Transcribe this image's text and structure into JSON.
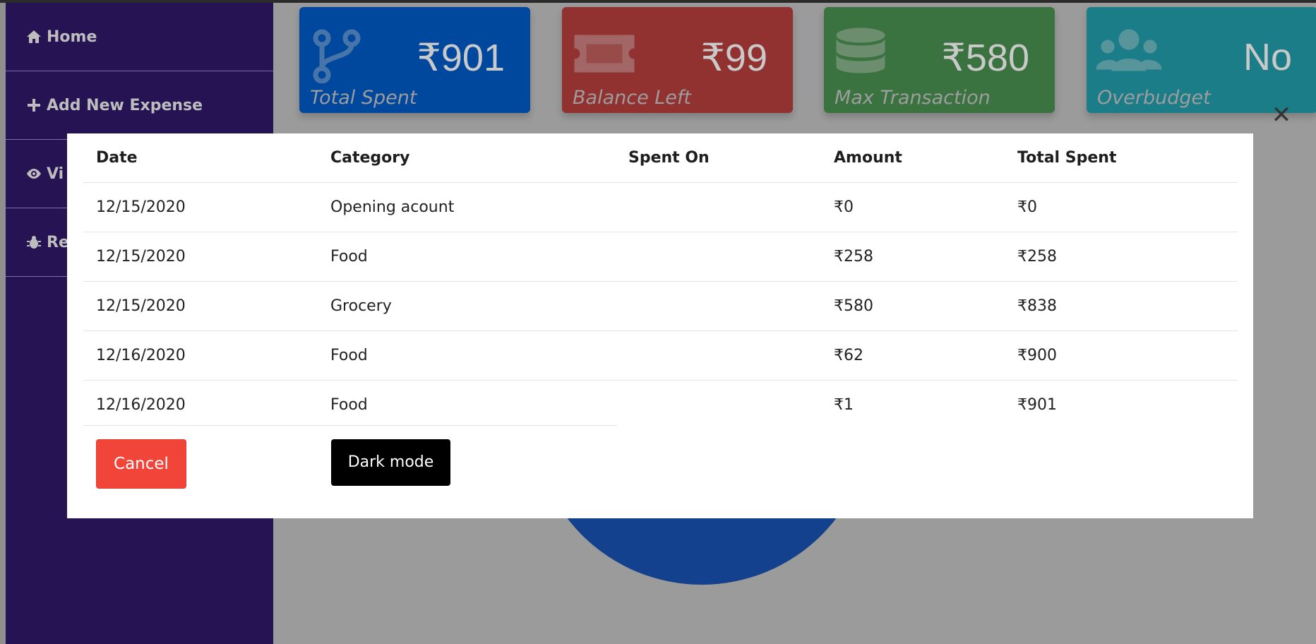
{
  "sidebar": {
    "items": [
      {
        "label": "Home",
        "icon": "home-icon"
      },
      {
        "label": "Add New Expense",
        "icon": "plus-icon"
      },
      {
        "label": "Vi",
        "icon": "eye-icon"
      },
      {
        "label": "Re",
        "icon": "bug-icon"
      }
    ]
  },
  "cards": [
    {
      "value": "₹901",
      "label": "Total Spent",
      "color": "#00489e",
      "icon": "fork-icon"
    },
    {
      "value": "₹99",
      "label": "Balance Left",
      "color": "#913130",
      "icon": "ticket-icon"
    },
    {
      "value": "₹580",
      "label": "Max Transaction",
      "color": "#3b7340",
      "icon": "database-icon"
    },
    {
      "value": "No",
      "label": "Overbudget",
      "color": "#1a7d88",
      "icon": "users-icon"
    }
  ],
  "modal": {
    "close_label": "✕",
    "headers": [
      "Date",
      "Category",
      "Spent On",
      "Amount",
      "Total Spent"
    ],
    "rows": [
      [
        "12/15/2020",
        "Opening acount",
        "",
        "₹0",
        "₹0"
      ],
      [
        "12/15/2020",
        "Food",
        "",
        "₹258",
        "₹258"
      ],
      [
        "12/15/2020",
        "Grocery",
        "",
        "₹580",
        "₹838"
      ],
      [
        "12/16/2020",
        "Food",
        "",
        "₹62",
        "₹900"
      ],
      [
        "12/16/2020",
        "Food",
        "",
        "₹1",
        "₹901"
      ]
    ],
    "cancel_label": "Cancel",
    "dark_mode_label": "Dark mode"
  },
  "colors": {
    "sidebar": "#261354",
    "overlay": "#9b9b9b",
    "cancel": "#f2453a",
    "pie": "#14418d"
  }
}
